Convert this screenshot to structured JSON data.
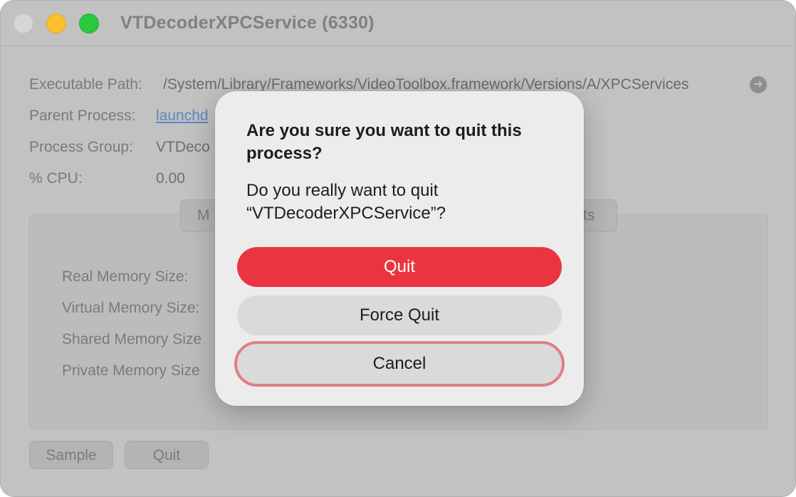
{
  "window": {
    "title": "VTDecoderXPCService (6330)"
  },
  "info": {
    "executable_path_label": "Executable Path:",
    "executable_path_value": "/System/Library/Frameworks/VideoToolbox.framework/Versions/A/XPCServices",
    "parent_process_label": "Parent Process:",
    "parent_process_value": "launchd",
    "process_group_label": "Process Group:",
    "process_group_value": "VTDeco",
    "cpu_label": "% CPU:",
    "cpu_value": "0.00"
  },
  "tabs": {
    "left_fragment": "M",
    "right_fragment": "ts"
  },
  "memory": {
    "real_label": "Real Memory Size:",
    "virtual_label": "Virtual Memory Size:",
    "shared_label": "Shared Memory Size",
    "private_label": "Private Memory Size"
  },
  "buttons": {
    "sample": "Sample",
    "quit": "Quit"
  },
  "dialog": {
    "title": "Are you sure you want to quit this process?",
    "message": "Do you really want to quit “VTDecoderXPCService”?",
    "quit_label": "Quit",
    "force_quit_label": "Force Quit",
    "cancel_label": "Cancel"
  },
  "colors": {
    "quit_button": "#ea3540",
    "focus_ring": "#df7f86",
    "link": "#5c86c3"
  }
}
